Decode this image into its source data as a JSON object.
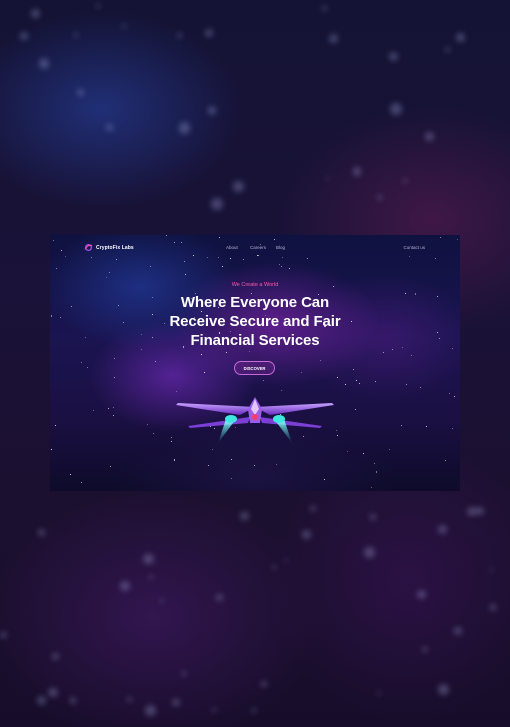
{
  "brand": {
    "name": "CryptoFix Labs",
    "logo_icon": "orbit-logo-icon"
  },
  "nav": {
    "links": [
      {
        "label": "About"
      },
      {
        "label": "Careers"
      },
      {
        "label": "Blog"
      }
    ],
    "contact_label": "Contact us"
  },
  "hero": {
    "eyebrow": "We Create a World",
    "headline_lines": [
      "Where Everyone Can",
      "Receive Secure and Fair",
      "Financial Services"
    ],
    "cta_label": "DISCOVER",
    "illustration_icon": "spaceship-icon"
  },
  "colors": {
    "accent_pink": "#ff5aa8",
    "button_border": "#c46bd7",
    "ship_purple": "#9b5de5",
    "thruster_cyan": "#3ee8e0"
  }
}
